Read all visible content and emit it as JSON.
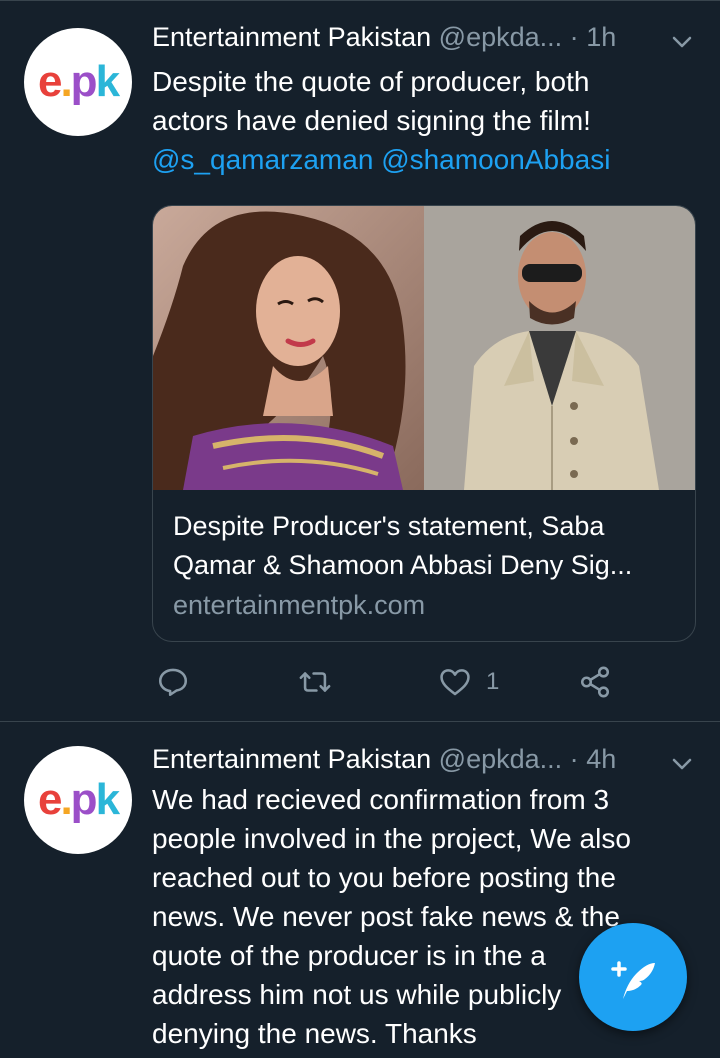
{
  "tweets": [
    {
      "name": "Entertainment Pakistan",
      "handle": "@epkda...",
      "separator": "·",
      "time": "1h",
      "text_line1": "Despite the quote of producer, both",
      "text_line2": "actors have denied signing the film!",
      "mention1": "@s_qamarzaman",
      "mention2": "@shamoonAbbasi",
      "card": {
        "title_line1": "Despite Producer's statement, Saba",
        "title_line2": "Qamar & Shamoon Abbasi Deny Sig...",
        "domain": "entertainmentpk.com"
      },
      "like_count": "1"
    },
    {
      "name": "Entertainment Pakistan",
      "handle": "@epkda...",
      "separator": "·",
      "time": "4h",
      "lines": [
        "We had recieved confirmation from 3",
        "people involved in the project, We also",
        "reached out to you before posting the",
        "news. We never post fake news & the",
        "quote of the producer is in the a",
        "address him not us while publicly",
        "denying the news. Thanks"
      ]
    }
  ],
  "avatar_logo": {
    "e": "e",
    "dot": ".",
    "p": "p",
    "k": "k"
  },
  "colors": {
    "background": "#15202b",
    "accent": "#1da1f2",
    "muted": "#8899a6",
    "divider": "#38444d"
  },
  "icons": {
    "reply": "reply-icon",
    "retweet": "retweet-icon",
    "like": "heart-icon",
    "share": "share-icon",
    "compose": "compose-tweet-icon",
    "caret": "chevron-down-icon"
  }
}
